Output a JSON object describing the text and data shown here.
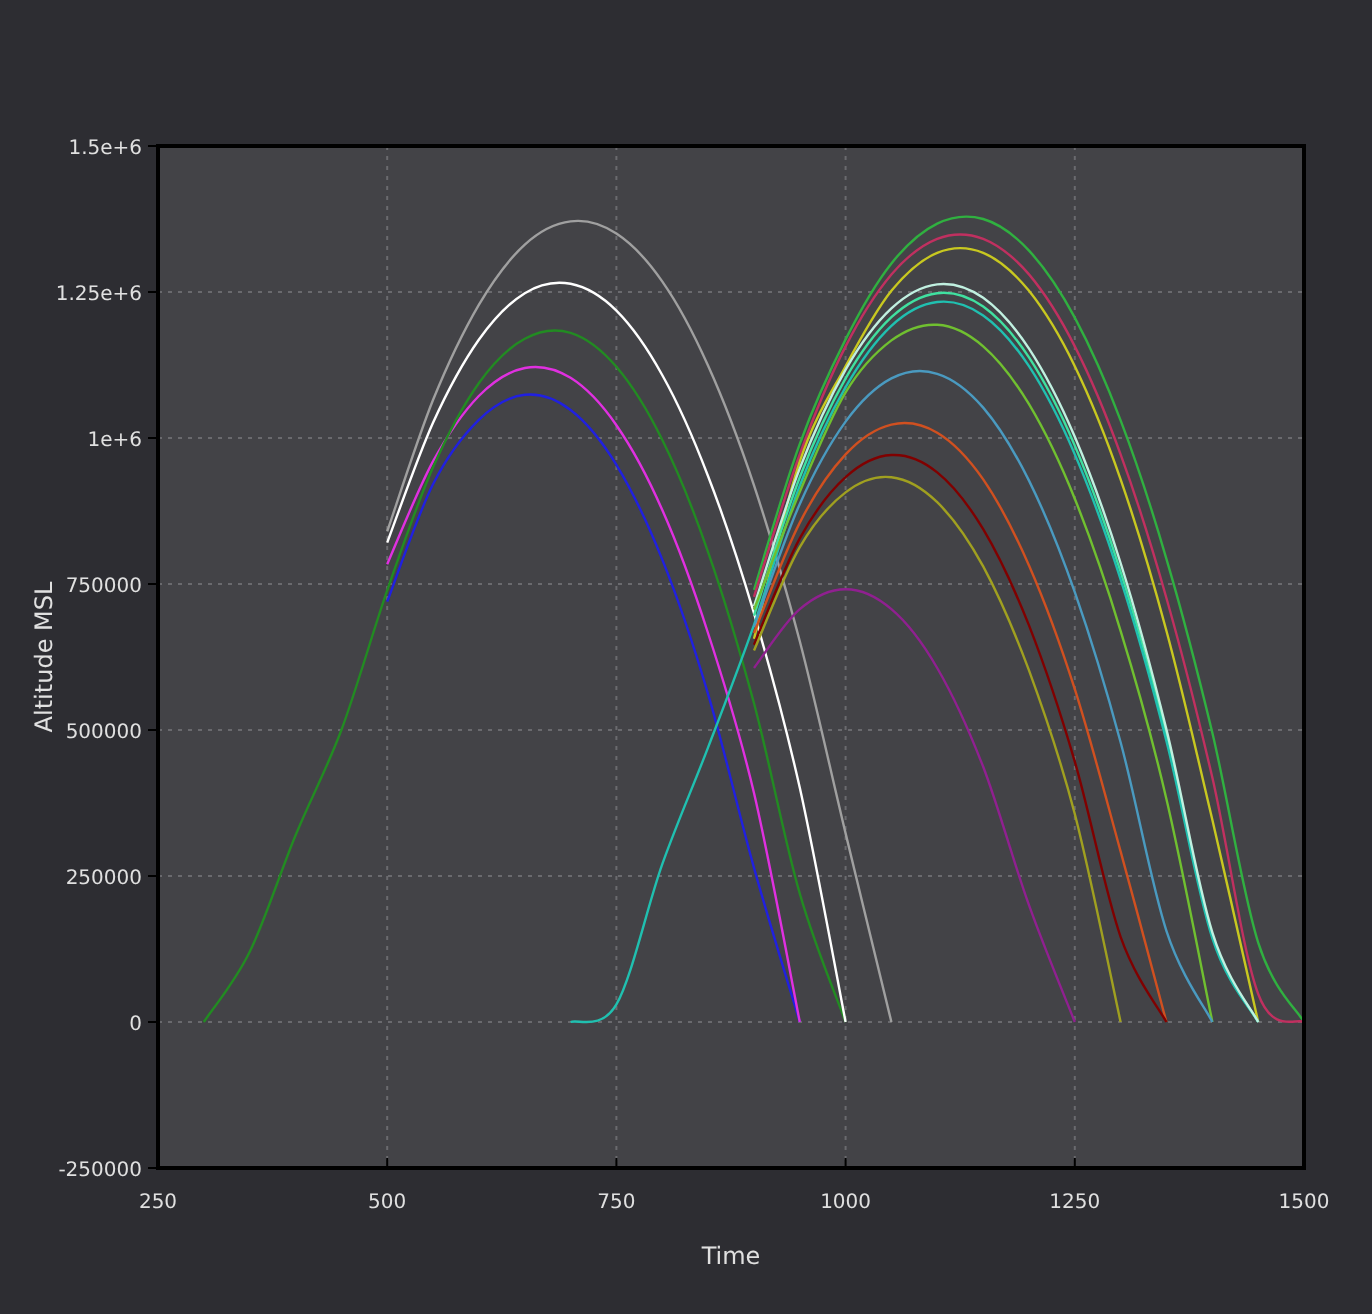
{
  "chart_data": {
    "type": "line",
    "xlabel": "Time",
    "ylabel": "Altitude MSL",
    "grid": true,
    "x": [
      300,
      350,
      400,
      450,
      500,
      550,
      600,
      650,
      700,
      750,
      800,
      850,
      900,
      950,
      1000,
      1050,
      1100,
      1150,
      1200,
      1250,
      1300,
      1350,
      1400,
      1450,
      1500
    ],
    "series": [
      {
        "color": "#2020e0",
        "values": [
          null,
          null,
          null,
          null,
          720000,
          921000,
          1031000,
          1074000,
          1048000,
          954000,
          792000,
          562000,
          264000,
          0,
          null,
          null,
          null,
          null,
          null,
          null,
          null,
          null,
          null,
          null,
          null
        ]
      },
      {
        "color": "#e030e0",
        "values": [
          null,
          null,
          null,
          null,
          784000,
          960000,
          1072000,
          1120000,
          1103000,
          1022000,
          877000,
          666000,
          392000,
          0,
          null,
          null,
          null,
          null,
          null,
          null,
          null,
          null,
          null,
          null,
          null
        ]
      },
      {
        "color": "#228b22",
        "values": [
          0,
          120000,
          320000,
          500000,
          739000,
          950000,
          1094000,
          1170000,
          1180000,
          1122000,
          997000,
          805000,
          546000,
          220000,
          0,
          null,
          null,
          null,
          null,
          null,
          null,
          null,
          null,
          null,
          null
        ]
      },
      {
        "color": "#ffffff",
        "values": [
          null,
          null,
          null,
          null,
          821000,
          1026000,
          1168000,
          1248000,
          1264000,
          1218000,
          1108000,
          935000,
          700000,
          401000,
          0,
          null,
          null,
          null,
          null,
          null,
          null,
          null,
          null,
          null,
          null
        ]
      },
      {
        "color": "#a0a0a0",
        "values": [
          null,
          null,
          null,
          null,
          840000,
          1065000,
          1228000,
          1331000,
          1371000,
          1350000,
          1268000,
          1124000,
          919000,
          652000,
          323000,
          0,
          null,
          null,
          null,
          null,
          null,
          null,
          null,
          null,
          null
        ]
      },
      {
        "color": "#30b040",
        "values": [
          null,
          null,
          null,
          null,
          null,
          null,
          null,
          null,
          null,
          null,
          null,
          null,
          740000,
          990000,
          1169000,
          1299000,
          1367000,
          1375000,
          1321000,
          1206000,
          1030000,
          793000,
          495000,
          136000,
          0
        ]
      },
      {
        "color": "#c03060",
        "values": [
          null,
          null,
          null,
          null,
          null,
          null,
          null,
          null,
          null,
          null,
          null,
          null,
          728000,
          972000,
          1157000,
          1280000,
          1341000,
          1341000,
          1280000,
          1157000,
          972000,
          726000,
          418000,
          48000,
          0
        ]
      },
      {
        "color": "#c8c820",
        "values": [
          null,
          null,
          null,
          null,
          null,
          null,
          null,
          null,
          null,
          null,
          null,
          null,
          656000,
          960000,
          1123000,
          1252000,
          1317000,
          1317000,
          1252000,
          1123000,
          929000,
          670000,
          346000,
          0,
          null
        ]
      },
      {
        "color": "#40e0a0",
        "values": [
          null,
          null,
          null,
          null,
          null,
          null,
          null,
          null,
          null,
          null,
          null,
          null,
          696000,
          933000,
          1102000,
          1207000,
          1248000,
          1225000,
          1138000,
          987000,
          771000,
          491000,
          148000,
          0,
          null
        ]
      },
      {
        "color": "#20c0b0",
        "values": [
          null,
          null,
          null,
          null,
          null,
          null,
          null,
          null,
          0,
          30000,
          270000,
          470000,
          680000,
          918000,
          1087000,
          1192000,
          1233000,
          1210000,
          1123000,
          972000,
          758000,
          481000,
          143000,
          0,
          null
        ]
      },
      {
        "color": "#c0f0e0",
        "values": [
          null,
          null,
          null,
          null,
          null,
          null,
          null,
          null,
          null,
          null,
          null,
          null,
          712000,
          948000,
          1117000,
          1222000,
          1263000,
          1240000,
          1153000,
          1002000,
          786000,
          501000,
          153000,
          0,
          null
        ]
      },
      {
        "color": "#70c030",
        "values": [
          null,
          null,
          null,
          null,
          null,
          null,
          null,
          null,
          null,
          null,
          null,
          null,
          706000,
          908000,
          1078000,
          1167000,
          1194000,
          1157000,
          1058000,
          896000,
          670000,
          382000,
          0,
          null,
          null
        ]
      },
      {
        "color": "#4a9ac0",
        "values": [
          null,
          null,
          null,
          null,
          null,
          null,
          null,
          null,
          null,
          null,
          null,
          null,
          676000,
          887000,
          1028000,
          1102000,
          1110000,
          1052000,
          927000,
          736000,
          479000,
          156000,
          0,
          null,
          null
        ]
      },
      {
        "color": "#d05020",
        "values": [
          null,
          null,
          null,
          null,
          null,
          null,
          null,
          null,
          null,
          null,
          null,
          null,
          666000,
          855000,
          972000,
          1023000,
          1009000,
          929000,
          782000,
          570000,
          292000,
          0,
          null,
          null,
          null
        ]
      },
      {
        "color": "#800000",
        "values": [
          null,
          null,
          null,
          null,
          null,
          null,
          null,
          null,
          null,
          null,
          null,
          null,
          646000,
          828000,
          933000,
          971000,
          941000,
          844000,
          679000,
          446000,
          146000,
          0,
          null,
          null,
          null
        ]
      },
      {
        "color": "#a0a020",
        "values": [
          null,
          null,
          null,
          null,
          null,
          null,
          null,
          null,
          null,
          null,
          null,
          null,
          636000,
          813000,
          907000,
          933000,
          890000,
          780000,
          602000,
          356000,
          0,
          null,
          null,
          null,
          null
        ]
      },
      {
        "color": "#902090",
        "values": [
          null,
          null,
          null,
          null,
          null,
          null,
          null,
          null,
          null,
          null,
          null,
          null,
          606000,
          707000,
          741000,
          707000,
          606000,
          437000,
          200000,
          0,
          null,
          null,
          null,
          null,
          null
        ]
      }
    ],
    "xlim": [
      250,
      1500
    ],
    "ylim": [
      -250000,
      1500000
    ],
    "xticks": [
      250,
      500,
      750,
      1000,
      1250,
      1500
    ],
    "yticks": [
      -250000,
      0,
      250000,
      500000,
      750000,
      {
        "value": 1000000,
        "label": "1e+6"
      },
      {
        "value": 1250000,
        "label": "1.25e+6"
      },
      {
        "value": 1500000,
        "label": "1.5e+6"
      }
    ]
  }
}
